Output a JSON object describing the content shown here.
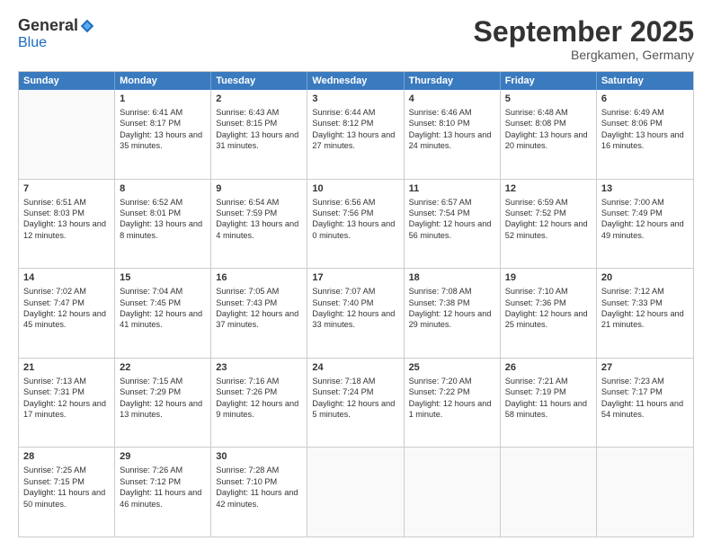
{
  "header": {
    "logo_general": "General",
    "logo_blue": "Blue",
    "month_title": "September 2025",
    "location": "Bergkamen, Germany"
  },
  "days_of_week": [
    "Sunday",
    "Monday",
    "Tuesday",
    "Wednesday",
    "Thursday",
    "Friday",
    "Saturday"
  ],
  "weeks": [
    [
      {
        "day": "",
        "empty": true
      },
      {
        "day": "1",
        "sunrise": "Sunrise: 6:41 AM",
        "sunset": "Sunset: 8:17 PM",
        "daylight": "Daylight: 13 hours and 35 minutes."
      },
      {
        "day": "2",
        "sunrise": "Sunrise: 6:43 AM",
        "sunset": "Sunset: 8:15 PM",
        "daylight": "Daylight: 13 hours and 31 minutes."
      },
      {
        "day": "3",
        "sunrise": "Sunrise: 6:44 AM",
        "sunset": "Sunset: 8:12 PM",
        "daylight": "Daylight: 13 hours and 27 minutes."
      },
      {
        "day": "4",
        "sunrise": "Sunrise: 6:46 AM",
        "sunset": "Sunset: 8:10 PM",
        "daylight": "Daylight: 13 hours and 24 minutes."
      },
      {
        "day": "5",
        "sunrise": "Sunrise: 6:48 AM",
        "sunset": "Sunset: 8:08 PM",
        "daylight": "Daylight: 13 hours and 20 minutes."
      },
      {
        "day": "6",
        "sunrise": "Sunrise: 6:49 AM",
        "sunset": "Sunset: 8:06 PM",
        "daylight": "Daylight: 13 hours and 16 minutes."
      }
    ],
    [
      {
        "day": "7",
        "sunrise": "Sunrise: 6:51 AM",
        "sunset": "Sunset: 8:03 PM",
        "daylight": "Daylight: 13 hours and 12 minutes."
      },
      {
        "day": "8",
        "sunrise": "Sunrise: 6:52 AM",
        "sunset": "Sunset: 8:01 PM",
        "daylight": "Daylight: 13 hours and 8 minutes."
      },
      {
        "day": "9",
        "sunrise": "Sunrise: 6:54 AM",
        "sunset": "Sunset: 7:59 PM",
        "daylight": "Daylight: 13 hours and 4 minutes."
      },
      {
        "day": "10",
        "sunrise": "Sunrise: 6:56 AM",
        "sunset": "Sunset: 7:56 PM",
        "daylight": "Daylight: 13 hours and 0 minutes."
      },
      {
        "day": "11",
        "sunrise": "Sunrise: 6:57 AM",
        "sunset": "Sunset: 7:54 PM",
        "daylight": "Daylight: 12 hours and 56 minutes."
      },
      {
        "day": "12",
        "sunrise": "Sunrise: 6:59 AM",
        "sunset": "Sunset: 7:52 PM",
        "daylight": "Daylight: 12 hours and 52 minutes."
      },
      {
        "day": "13",
        "sunrise": "Sunrise: 7:00 AM",
        "sunset": "Sunset: 7:49 PM",
        "daylight": "Daylight: 12 hours and 49 minutes."
      }
    ],
    [
      {
        "day": "14",
        "sunrise": "Sunrise: 7:02 AM",
        "sunset": "Sunset: 7:47 PM",
        "daylight": "Daylight: 12 hours and 45 minutes."
      },
      {
        "day": "15",
        "sunrise": "Sunrise: 7:04 AM",
        "sunset": "Sunset: 7:45 PM",
        "daylight": "Daylight: 12 hours and 41 minutes."
      },
      {
        "day": "16",
        "sunrise": "Sunrise: 7:05 AM",
        "sunset": "Sunset: 7:43 PM",
        "daylight": "Daylight: 12 hours and 37 minutes."
      },
      {
        "day": "17",
        "sunrise": "Sunrise: 7:07 AM",
        "sunset": "Sunset: 7:40 PM",
        "daylight": "Daylight: 12 hours and 33 minutes."
      },
      {
        "day": "18",
        "sunrise": "Sunrise: 7:08 AM",
        "sunset": "Sunset: 7:38 PM",
        "daylight": "Daylight: 12 hours and 29 minutes."
      },
      {
        "day": "19",
        "sunrise": "Sunrise: 7:10 AM",
        "sunset": "Sunset: 7:36 PM",
        "daylight": "Daylight: 12 hours and 25 minutes."
      },
      {
        "day": "20",
        "sunrise": "Sunrise: 7:12 AM",
        "sunset": "Sunset: 7:33 PM",
        "daylight": "Daylight: 12 hours and 21 minutes."
      }
    ],
    [
      {
        "day": "21",
        "sunrise": "Sunrise: 7:13 AM",
        "sunset": "Sunset: 7:31 PM",
        "daylight": "Daylight: 12 hours and 17 minutes."
      },
      {
        "day": "22",
        "sunrise": "Sunrise: 7:15 AM",
        "sunset": "Sunset: 7:29 PM",
        "daylight": "Daylight: 12 hours and 13 minutes."
      },
      {
        "day": "23",
        "sunrise": "Sunrise: 7:16 AM",
        "sunset": "Sunset: 7:26 PM",
        "daylight": "Daylight: 12 hours and 9 minutes."
      },
      {
        "day": "24",
        "sunrise": "Sunrise: 7:18 AM",
        "sunset": "Sunset: 7:24 PM",
        "daylight": "Daylight: 12 hours and 5 minutes."
      },
      {
        "day": "25",
        "sunrise": "Sunrise: 7:20 AM",
        "sunset": "Sunset: 7:22 PM",
        "daylight": "Daylight: 12 hours and 1 minute."
      },
      {
        "day": "26",
        "sunrise": "Sunrise: 7:21 AM",
        "sunset": "Sunset: 7:19 PM",
        "daylight": "Daylight: 11 hours and 58 minutes."
      },
      {
        "day": "27",
        "sunrise": "Sunrise: 7:23 AM",
        "sunset": "Sunset: 7:17 PM",
        "daylight": "Daylight: 11 hours and 54 minutes."
      }
    ],
    [
      {
        "day": "28",
        "sunrise": "Sunrise: 7:25 AM",
        "sunset": "Sunset: 7:15 PM",
        "daylight": "Daylight: 11 hours and 50 minutes."
      },
      {
        "day": "29",
        "sunrise": "Sunrise: 7:26 AM",
        "sunset": "Sunset: 7:12 PM",
        "daylight": "Daylight: 11 hours and 46 minutes."
      },
      {
        "day": "30",
        "sunrise": "Sunrise: 7:28 AM",
        "sunset": "Sunset: 7:10 PM",
        "daylight": "Daylight: 11 hours and 42 minutes."
      },
      {
        "day": "",
        "empty": true
      },
      {
        "day": "",
        "empty": true
      },
      {
        "day": "",
        "empty": true
      },
      {
        "day": "",
        "empty": true
      }
    ]
  ]
}
